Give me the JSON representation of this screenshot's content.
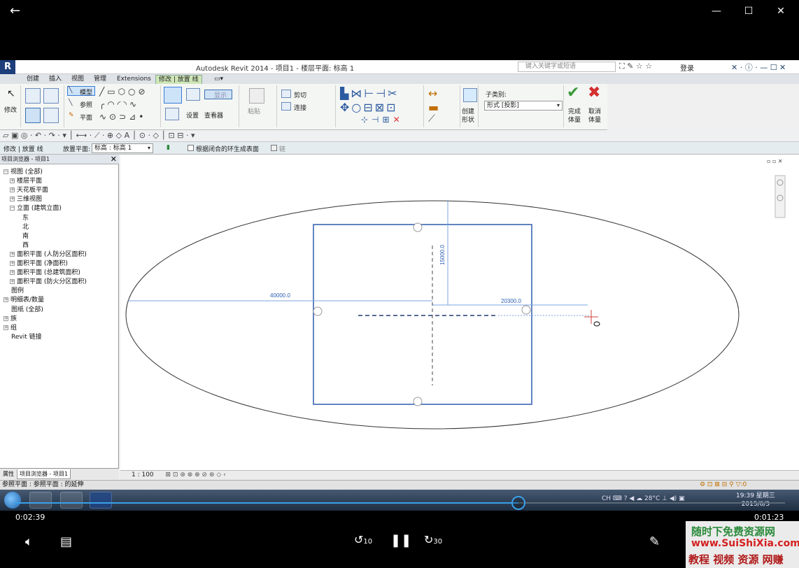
{
  "player": {
    "back_icon": "←",
    "minimize": "—",
    "maximize": "☐",
    "close": "✕",
    "time_elapsed": "0:02:39",
    "time_remaining": "0:01:23",
    "progress": 0.654,
    "skip_back_label": "10",
    "skip_forward_label": "30"
  },
  "revit": {
    "title": "Autodesk Revit 2014 -   项目1 - 楼层平面: 标高 1",
    "search_placeholder": "键入关键字或短语",
    "login": "登录",
    "tabs": [
      "创建",
      "插入",
      "视图",
      "管理",
      "Extensions",
      "修改 | 放置 线"
    ],
    "active_tab_index": 5,
    "ribbon": {
      "modify": "修改",
      "model": "模型",
      "reference": "参照",
      "plane": "平面",
      "set": "设置",
      "show": "显示",
      "viewer": "查看器",
      "paste": "粘贴",
      "cut": "剪切",
      "join": "连接",
      "create_form_1": "创建",
      "create_form_2": "形状",
      "subcategory": "子类别:",
      "subcategory_value": "形式 [投影]",
      "finish_1": "完成",
      "finish_2": "体量",
      "cancel_1": "取消",
      "cancel_2": "体量"
    },
    "options_bar": {
      "context": "修改 | 放置 线",
      "placement_label": "放置平面:",
      "placement_value": "标高 : 标高 1",
      "checkbox_label": "根据闭合的环生成表面",
      "chain_label": "链"
    },
    "browser": {
      "title": "项目浏览器 - 项目1",
      "items": [
        {
          "label": "视图 (全部)",
          "indent": 0,
          "exp": "−"
        },
        {
          "label": "楼层平面",
          "indent": 1,
          "exp": "+"
        },
        {
          "label": "天花板平面",
          "indent": 1,
          "exp": "+"
        },
        {
          "label": "三维视图",
          "indent": 1,
          "exp": "+"
        },
        {
          "label": "立面 (建筑立面)",
          "indent": 1,
          "exp": "−"
        },
        {
          "label": "东",
          "indent": 3,
          "exp": ""
        },
        {
          "label": "北",
          "indent": 3,
          "exp": ""
        },
        {
          "label": "南",
          "indent": 3,
          "exp": ""
        },
        {
          "label": "西",
          "indent": 3,
          "exp": ""
        },
        {
          "label": "面积平面 (人防分区面积)",
          "indent": 1,
          "exp": "+"
        },
        {
          "label": "面积平面 (净面积)",
          "indent": 1,
          "exp": "+"
        },
        {
          "label": "面积平面 (总建筑面积)",
          "indent": 1,
          "exp": "+"
        },
        {
          "label": "面积平面 (防火分区面积)",
          "indent": 1,
          "exp": "+"
        },
        {
          "label": "图例",
          "indent": 0,
          "exp": ""
        },
        {
          "label": "明细表/数量",
          "indent": 0,
          "exp": "+"
        },
        {
          "label": "图纸 (全部)",
          "indent": 0,
          "exp": ""
        },
        {
          "label": "族",
          "indent": 0,
          "exp": "+"
        },
        {
          "label": "组",
          "indent": 0,
          "exp": "+"
        },
        {
          "label": "Revit 链接",
          "indent": 0,
          "exp": ""
        }
      ],
      "tab_properties": "属性",
      "tab_browser": "项目浏览器 - 项目1"
    },
    "drawing": {
      "dim_left": "40000.0",
      "dim_right": "20300.0",
      "dim_top": "15000.0"
    },
    "scale": "1 : 100",
    "status": "参照平面 : 参照平面 : 的延伸"
  },
  "taskbar": {
    "time": "19:39 星期三",
    "date": "2015/6/3",
    "temperature": "28°C"
  },
  "watermark": {
    "line1": "随时下免费资源网",
    "line2": "www.SuiShiXia.com",
    "line3": "教程 视频 资源 网赚"
  }
}
